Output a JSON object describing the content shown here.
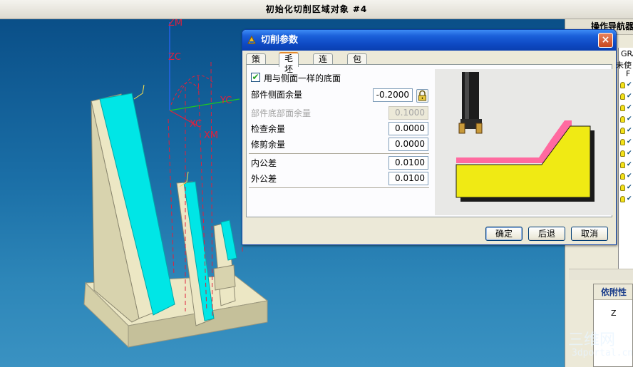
{
  "window": {
    "title": "初始化切削区域对象 #4"
  },
  "viewport": {
    "axes": {
      "zm": "ZM",
      "zc": "ZC",
      "yc": "YC",
      "xc": "XC",
      "xm": "XM"
    },
    "colors": {
      "background": "#1a6ea6",
      "part": "#ece7c4",
      "wall": "#00e6e6",
      "axis": "#e0203c"
    }
  },
  "nav": {
    "title": "操作导航器",
    "items": [
      "GRAP",
      "未使",
      "F"
    ]
  },
  "dependency": {
    "title": "依附性",
    "item": "Z"
  },
  "dialog": {
    "title": "切削参数",
    "close_label": "×",
    "tabs": [
      "策略",
      "毛坯",
      "连接",
      "包容"
    ],
    "active_tab": "毛坯",
    "checkbox": {
      "label": "用与侧面一样的底面",
      "checked": true
    },
    "fields": [
      {
        "label": "部件侧面余量",
        "value": "-0.2000",
        "enabled": true
      },
      {
        "label": "部件底部面余量",
        "value": "0.1000",
        "enabled": false
      },
      {
        "label": "检查余量",
        "value": "0.0000",
        "enabled": true
      },
      {
        "label": "修剪余量",
        "value": "0.0000",
        "enabled": true
      },
      {
        "label": "内公差",
        "value": "0.0100",
        "enabled": true
      },
      {
        "label": "外公差",
        "value": "0.0100",
        "enabled": true
      }
    ],
    "buttons": {
      "ok": "确定",
      "back": "后退",
      "cancel": "取消"
    },
    "preview_colors": {
      "stock": "#ff6aa0",
      "part": "#f0ea14"
    }
  },
  "watermark": {
    "text": "3dportal.cn",
    "logo": "三维网"
  }
}
